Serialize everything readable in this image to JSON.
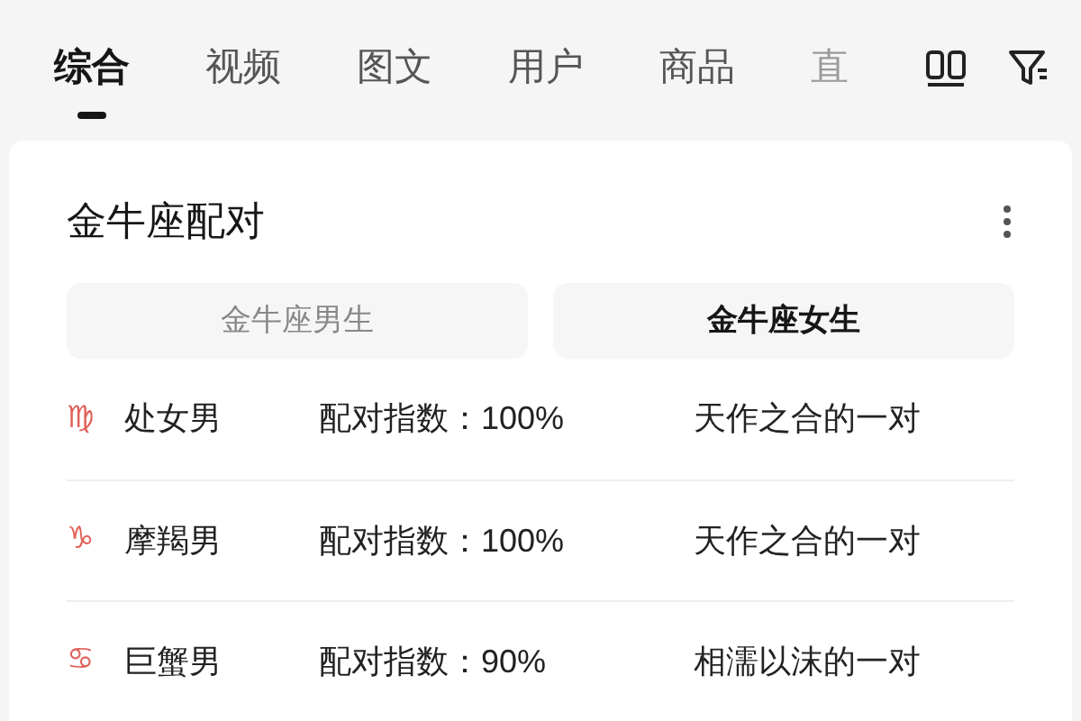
{
  "tabs": [
    {
      "label": "综合",
      "selected": true
    },
    {
      "label": "视频",
      "selected": false
    },
    {
      "label": "图文",
      "selected": false
    },
    {
      "label": "用户",
      "selected": false
    },
    {
      "label": "商品",
      "selected": false
    },
    {
      "label": "直",
      "selected": false
    }
  ],
  "card": {
    "title": "金牛座配对",
    "toggles": [
      {
        "label": "金牛座男生",
        "selected": false
      },
      {
        "label": "金牛座女生",
        "selected": true
      }
    ],
    "rows": [
      {
        "sign": "♍",
        "name": "处女男",
        "score": "配对指数：100%",
        "desc": "天作之合的一对"
      },
      {
        "sign": "♑",
        "name": "摩羯男",
        "score": "配对指数：100%",
        "desc": "天作之合的一对"
      },
      {
        "sign": "♋",
        "name": "巨蟹男",
        "score": "配对指数：90%",
        "desc": "相濡以沫的一对"
      }
    ]
  }
}
